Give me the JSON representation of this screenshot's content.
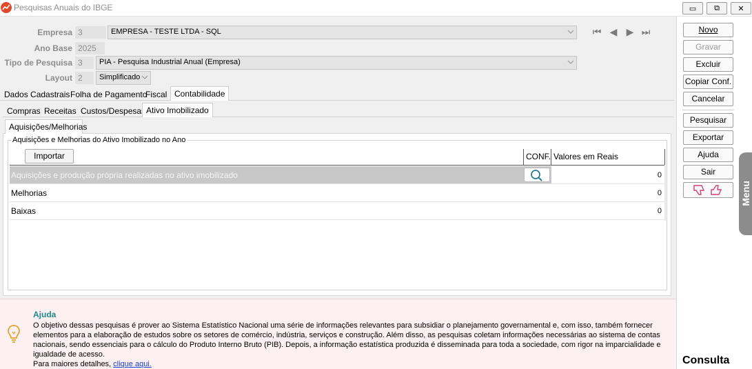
{
  "window": {
    "title": "Pesquisas Anuais do IBGE",
    "controls": {
      "minimize": "▭",
      "restore": "⧉",
      "close": "✕"
    }
  },
  "form": {
    "empresa": {
      "label": "Empresa",
      "code": "3",
      "value": "EMPRESA - TESTE LTDA - SQL"
    },
    "ano_base": {
      "label": "Ano Base",
      "value": "2025"
    },
    "tipo_pesquisa": {
      "label": "Tipo de Pesquisa",
      "code": "3",
      "value": "PIA - Pesquisa Industrial Anual (Empresa)"
    },
    "layout": {
      "label": "Layout",
      "code": "2",
      "value": "Simplificado"
    }
  },
  "tabs_main": [
    "Dados Cadastrais",
    "Folha de Pagamento",
    "Fiscal",
    "Contabilidade"
  ],
  "tabs_sub": [
    "Compras",
    "Receitas",
    "Custos/Despesas",
    "Ativo Imobilizado"
  ],
  "tabs_inner": [
    "Aquisições/Melhorias"
  ],
  "group": {
    "title": "Aquisições e Melhorias do Ativo Imobilizado no Ano",
    "import_button": "Importar",
    "columns": {
      "conf": "CONF.",
      "valores": "Valores em Reais"
    },
    "rows": [
      {
        "name": "Aquisições e produção própria realizadas no ativo imobilizado",
        "value": "0"
      },
      {
        "name": "Melhorias",
        "value": "0"
      },
      {
        "name": "Baixas",
        "value": "0"
      }
    ]
  },
  "help": {
    "title": "Ajuda",
    "text": "O objetivo dessas pesquisas é prover ao Sistema Estatístico Nacional uma série de informações relevantes para subsidiar o planejamento governamental e, com isso, também fornecer elementos para a elaboração de estudos sobre os setores de comércio, indústria, serviços e construção. Além disso, as pesquisas coletam informações necessárias ao sistema de contas nacionais, sendo essenciais para o cálculo do Produto Interno Bruto (PIB). Depois, a informação estatística produzida é disseminada para toda a sociedade, com rigor na imparcialidade e igualdade de acesso.",
    "more_prefix": "Para maiores detalhes, ",
    "more_link": "clique aqui."
  },
  "actions": [
    "Novo",
    "Gravar",
    "Excluir",
    "Copiar Conf.",
    "Cancelar",
    "Pesquisar",
    "Exportar",
    "Ajuda",
    "Sair"
  ],
  "side_menu_label": "Menu",
  "mode": "Consulta",
  "colors": {
    "help_title": "#1f8a8a",
    "link": "#1a3fcf",
    "feedback": "#d0407a",
    "app_icon": "#e04a2a"
  }
}
